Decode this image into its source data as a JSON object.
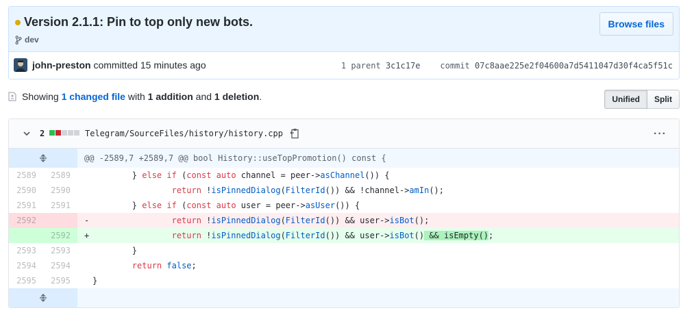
{
  "commit": {
    "title": "Version 2.1.1: Pin to top only new bots.",
    "branch": "dev",
    "browse_label": "Browse files",
    "author": "john-preston",
    "committed_text": "committed 15 minutes ago",
    "parents_label": "1 parent",
    "parent_sha": "3c1c17e",
    "commit_label": "commit",
    "commit_sha": "07c8aae225e2f04600a7d5411047d30f4ca5f51c"
  },
  "summary": {
    "showing": "Showing",
    "changed_files": "1 changed file",
    "with": "with",
    "additions": "1 addition",
    "and": "and",
    "deletions": "1 deletion",
    "period": "."
  },
  "view_toggle": {
    "unified": "Unified",
    "split": "Split"
  },
  "file": {
    "change_count": "2",
    "path": "Telegram/SourceFiles/history/history.cpp",
    "hunk_header": "@@ -2589,7 +2589,7 @@ bool History::useTopPromotion() const {",
    "kebab": "···"
  },
  "colors": {
    "added": "#2cbe4e",
    "deleted": "#cb2431",
    "neutral": "#d1d5da",
    "status_pending": "#dbab09",
    "link": "#0366d6"
  }
}
